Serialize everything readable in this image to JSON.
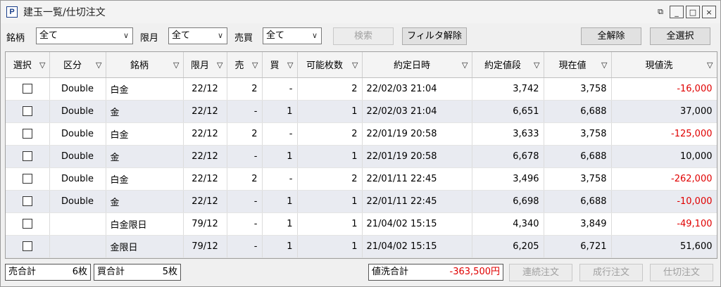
{
  "window": {
    "icon_letter": "P",
    "title": "建玉一覧/仕切注文",
    "restore_glyph": "⧉",
    "minimize_glyph": "_",
    "maximize_glyph": "□",
    "close_glyph": "×"
  },
  "filters": {
    "brand_label": "銘柄",
    "brand_value": "全て",
    "month_label": "限月",
    "month_value": "全て",
    "side_label": "売買",
    "side_value": "全て",
    "search_label": "検索",
    "filter_clear_label": "フィルタ解除",
    "clear_all_label": "全解除",
    "select_all_label": "全選択"
  },
  "table": {
    "headers": [
      "選択",
      "区分",
      "銘柄",
      "限月",
      "売",
      "買",
      "可能枚数",
      "約定日時",
      "約定値段",
      "現在値",
      "現値洗"
    ],
    "rows": [
      {
        "type": "Double",
        "brand": "白金",
        "month": "22/12",
        "sell": "2",
        "buy": "-",
        "qty": "2",
        "datetime": "22/02/03 21:04",
        "price": "3,742",
        "current": "3,758",
        "pl": "-16,000",
        "neg": true
      },
      {
        "type": "Double",
        "brand": "金",
        "month": "22/12",
        "sell": "-",
        "buy": "1",
        "qty": "1",
        "datetime": "22/02/03 21:04",
        "price": "6,651",
        "current": "6,688",
        "pl": "37,000",
        "neg": false
      },
      {
        "type": "Double",
        "brand": "白金",
        "month": "22/12",
        "sell": "2",
        "buy": "-",
        "qty": "2",
        "datetime": "22/01/19 20:58",
        "price": "3,633",
        "current": "3,758",
        "pl": "-125,000",
        "neg": true
      },
      {
        "type": "Double",
        "brand": "金",
        "month": "22/12",
        "sell": "-",
        "buy": "1",
        "qty": "1",
        "datetime": "22/01/19 20:58",
        "price": "6,678",
        "current": "6,688",
        "pl": "10,000",
        "neg": false
      },
      {
        "type": "Double",
        "brand": "白金",
        "month": "22/12",
        "sell": "2",
        "buy": "-",
        "qty": "2",
        "datetime": "22/01/11 22:45",
        "price": "3,496",
        "current": "3,758",
        "pl": "-262,000",
        "neg": true
      },
      {
        "type": "Double",
        "brand": "金",
        "month": "22/12",
        "sell": "-",
        "buy": "1",
        "qty": "1",
        "datetime": "22/01/11 22:45",
        "price": "6,698",
        "current": "6,688",
        "pl": "-10,000",
        "neg": true
      },
      {
        "type": "",
        "brand": "白金限日",
        "month": "79/12",
        "sell": "-",
        "buy": "1",
        "qty": "1",
        "datetime": "21/04/02 15:15",
        "price": "4,340",
        "current": "3,849",
        "pl": "-49,100",
        "neg": true
      },
      {
        "type": "",
        "brand": "金限日",
        "month": "79/12",
        "sell": "-",
        "buy": "1",
        "qty": "1",
        "datetime": "21/04/02 15:15",
        "price": "6,205",
        "current": "6,721",
        "pl": "51,600",
        "neg": false
      }
    ]
  },
  "status": {
    "sell_total_label": "売合計",
    "sell_total_value": "6枚",
    "buy_total_label": "買合計",
    "buy_total_value": "5枚",
    "pl_total_label": "値洗合計",
    "pl_total_value": "-363,500円",
    "continuous_order_label": "連続注文",
    "market_order_label": "成行注文",
    "close_order_label": "仕切注文"
  },
  "colors": {
    "negative": "#e00000",
    "alt_row": "#e9ebf1"
  }
}
